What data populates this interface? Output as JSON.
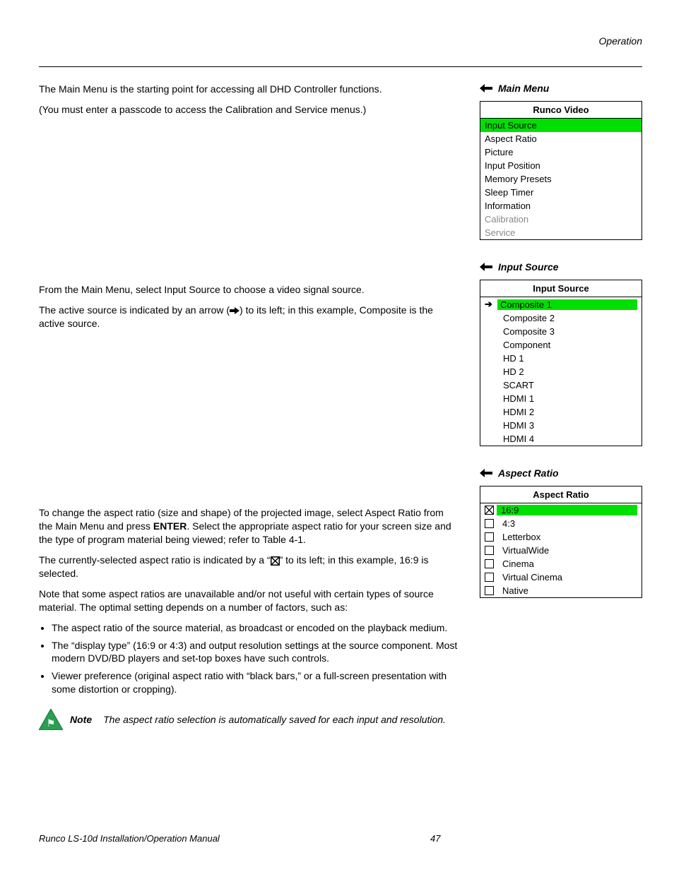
{
  "header": {
    "section": "Operation"
  },
  "body": {
    "p1": "The Main Menu is the starting point for accessing all DHD Controller functions.",
    "p2": "(You must enter a passcode to access the Calibration and Service menus.)",
    "p3": "From the Main Menu, select Input Source to choose a video signal source.",
    "p4a": "The active source is indicated by an arrow (",
    "p4b": ") to its left; in this example, Composite is the active source.",
    "p5_a": "To change the aspect ratio (size and shape) of the projected image, select Aspect Ratio from the Main Menu and press ",
    "p5_enter": "ENTER",
    "p5_b": ". Select the appropriate aspect ratio for your screen size and the type of program material being viewed; refer to Table 4-1.",
    "p6a": "The currently-selected aspect ratio is indicated by a “",
    "p6b": "” to its left; in this example, 16:9 is selected.",
    "p7": "Note that some aspect ratios are unavailable and/or not useful with certain types of source material. The optimal setting depends on a number of factors, such as:",
    "li1": "The aspect ratio of the source material, as broadcast or encoded on the playback medium.",
    "li2": "The “display type” (16:9 or 4:3) and output resolution settings at the source component. Most modern DVD/BD players and set-top boxes have such controls.",
    "li3": "Viewer preference (original aspect ratio with “black bars,” or a full-screen presentation with some distortion or cropping).",
    "note_label": "Note",
    "note_text": "The aspect ratio selection is automatically saved for each input and resolution."
  },
  "side": {
    "mainmenu_heading": "Main Menu",
    "inputsource_heading": "Input Source",
    "aspectratio_heading": "Aspect Ratio",
    "mainmenu": {
      "title": "Runco Video",
      "items": [
        "Input Source",
        "Aspect Ratio",
        "Picture",
        "Input Position",
        "Memory Presets",
        "Sleep Timer",
        "Information",
        "Calibration",
        "Service"
      ]
    },
    "inputsource": {
      "title": "Input Source",
      "items": [
        "Composite 1",
        "Composite 2",
        "Composite 3",
        "Component",
        "HD 1",
        "HD 2",
        "SCART",
        "HDMI 1",
        "HDMI 2",
        "HDMI 3",
        "HDMI 4"
      ]
    },
    "aspectratio": {
      "title": "Aspect Ratio",
      "items": [
        "16:9",
        "4:3",
        "Letterbox",
        "VirtualWide",
        "Cinema",
        "Virtual Cinema",
        "Native"
      ]
    }
  },
  "footer": {
    "title": "Runco LS-10d Installation/Operation Manual",
    "page": "47"
  }
}
